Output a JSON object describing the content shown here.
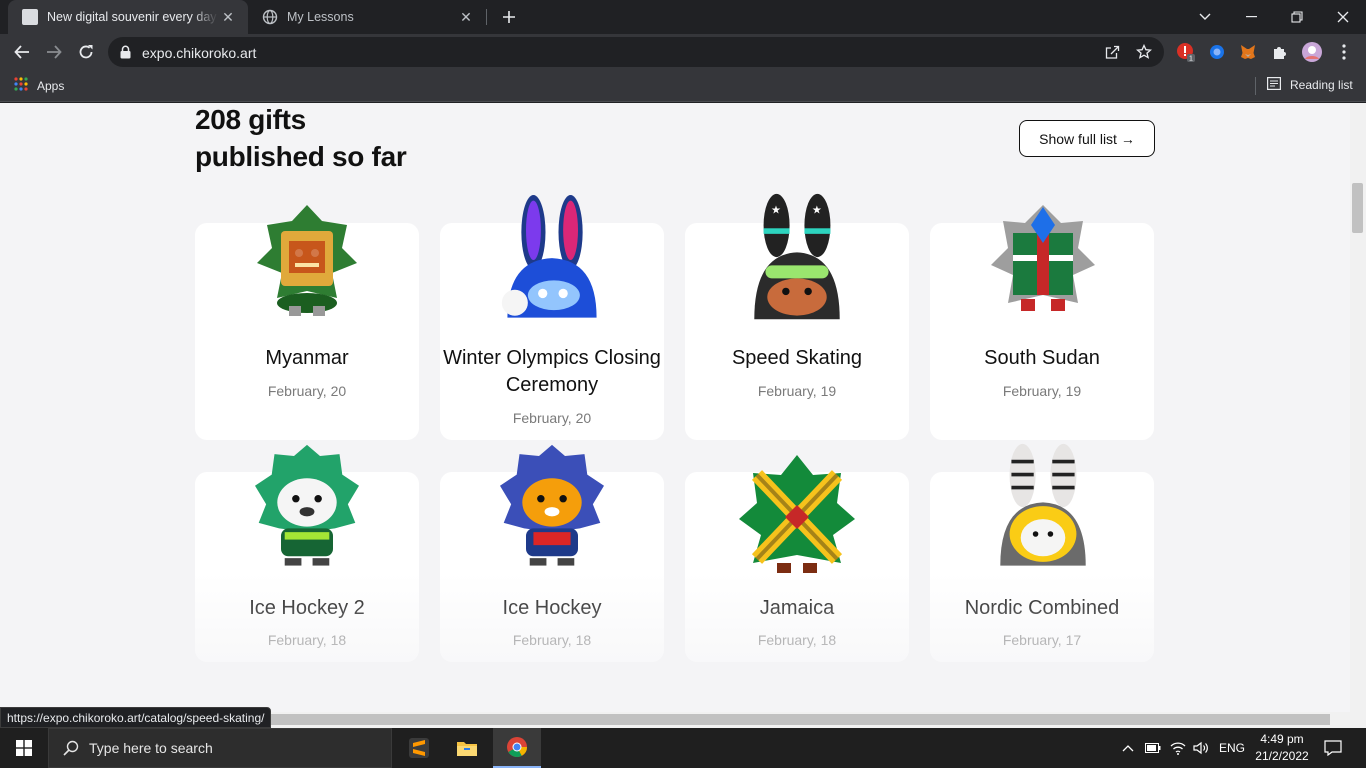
{
  "browser": {
    "tabs": [
      {
        "title": "New digital souvenir every day of",
        "active": true
      },
      {
        "title": "My Lessons",
        "active": false
      }
    ],
    "url": "expo.chikoroko.art",
    "bookmarks": {
      "apps": "Apps",
      "reading_list": "Reading list"
    },
    "extension_badge": "1",
    "status_url": "https://expo.chikoroko.art/catalog/speed-skating/"
  },
  "page": {
    "heading_line1": "208 gifts",
    "heading_line2": "published so far",
    "show_full_list": "Show full list →",
    "cards": [
      {
        "name": "Myanmar",
        "date": "February, 20",
        "art": "myanmar-figure-icon"
      },
      {
        "name": "Winter Olympics Closing Ceremony",
        "date": "February, 20",
        "art": "closing-ceremony-bunny-icon"
      },
      {
        "name": "Speed Skating",
        "date": "February, 19",
        "art": "speed-skating-bunny-icon"
      },
      {
        "name": "South Sudan",
        "date": "February, 19",
        "art": "south-sudan-figure-icon"
      },
      {
        "name": "Ice Hockey 2",
        "date": "February, 18",
        "art": "ice-hockey-2-tiger-icon"
      },
      {
        "name": "Ice Hockey",
        "date": "February, 18",
        "art": "ice-hockey-tiger-icon"
      },
      {
        "name": "Jamaica",
        "date": "February, 18",
        "art": "jamaica-figure-icon"
      },
      {
        "name": "Nordic Combined",
        "date": "February, 17",
        "art": "nordic-combined-bunny-icon"
      }
    ]
  },
  "taskbar": {
    "search_placeholder": "Type here to search",
    "language": "ENG",
    "time": "4:49 pm",
    "date": "21/2/2022"
  }
}
